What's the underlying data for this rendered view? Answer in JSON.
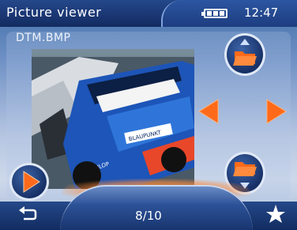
{
  "header": {
    "title": "Picture viewer",
    "time": "12:47",
    "battery_icon": "battery-icon"
  },
  "viewer": {
    "filename": "DTM.BMP",
    "counter": "8/10",
    "photo_text": {
      "sponsor": "BLAUPUNKT",
      "brand": "DUNLOP"
    }
  },
  "colors": {
    "accent_orange": "#ff6a1a",
    "bar_blue": "#1a3572"
  }
}
